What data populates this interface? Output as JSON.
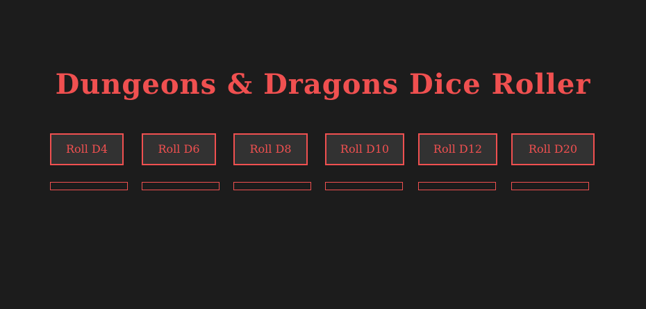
{
  "header": {
    "title": "Dungeons & Dragons Dice Roller"
  },
  "dice": [
    {
      "label": "Roll D4",
      "result": ""
    },
    {
      "label": "Roll D6",
      "result": ""
    },
    {
      "label": "Roll D8",
      "result": ""
    },
    {
      "label": "Roll D10",
      "result": ""
    },
    {
      "label": "Roll D12",
      "result": ""
    },
    {
      "label": "Roll D20",
      "result": ""
    }
  ],
  "colors": {
    "background": "#1c1c1c",
    "accent": "#f05050",
    "button_bg": "#323232"
  }
}
